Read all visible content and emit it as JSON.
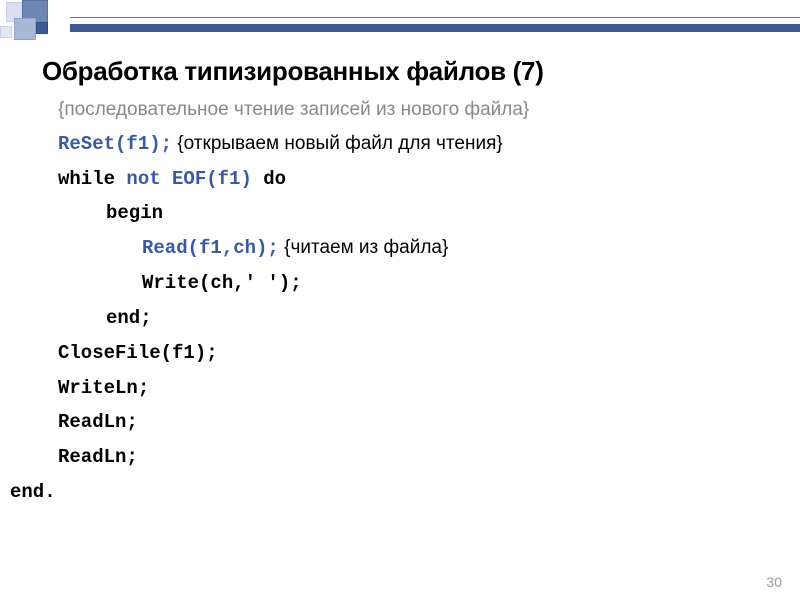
{
  "slide": {
    "title": "Обработка типизированных файлов (7)",
    "page_number": "30",
    "lines": [
      {
        "indent": "ind1",
        "parts": [
          {
            "cls": "gray",
            "text": "{последовательное чтение записей из нового файла}"
          }
        ]
      },
      {
        "indent": "ind1",
        "parts": [
          {
            "cls": "code blue",
            "text": "ReSet(f1);"
          },
          {
            "cls": "plain",
            "text": "    {открываем новый файл для чтения}"
          }
        ]
      },
      {
        "indent": "ind1",
        "parts": [
          {
            "cls": "code",
            "text": "while "
          },
          {
            "cls": "code blue",
            "text": "not EOF(f1)"
          },
          {
            "cls": "code",
            "text": " do"
          }
        ]
      },
      {
        "indent": "ind2",
        "parts": [
          {
            "cls": "code",
            "text": "begin"
          }
        ]
      },
      {
        "indent": "ind3",
        "parts": [
          {
            "cls": "code blue",
            "text": "Read(f1,ch);"
          },
          {
            "cls": "plain",
            "text": "  {читаем из файла}"
          }
        ]
      },
      {
        "indent": "ind3",
        "parts": [
          {
            "cls": "code",
            "text": "Write(ch,' ');"
          }
        ]
      },
      {
        "indent": "ind2",
        "parts": [
          {
            "cls": "code",
            "text": "end;"
          }
        ]
      },
      {
        "indent": "ind1",
        "parts": [
          {
            "cls": "code",
            "text": "CloseFile(f1);"
          }
        ]
      },
      {
        "indent": "ind1",
        "parts": [
          {
            "cls": "code",
            "text": "WriteLn;"
          }
        ]
      },
      {
        "indent": "ind1",
        "parts": [
          {
            "cls": "code",
            "text": "ReadLn;"
          }
        ]
      },
      {
        "indent": "ind1",
        "parts": [
          {
            "cls": "code",
            "text": "ReadLn;"
          }
        ]
      },
      {
        "indent": "noindent",
        "parts": [
          {
            "cls": "code",
            "text": "end."
          }
        ]
      }
    ]
  }
}
